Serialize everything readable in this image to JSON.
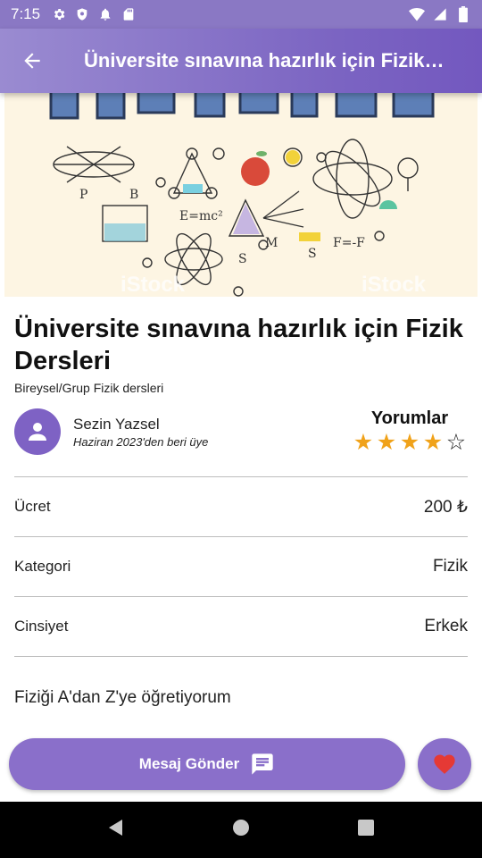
{
  "status_bar": {
    "time": "7:15",
    "icons_left": [
      "gear-icon",
      "shield-icon",
      "bell-icon",
      "sd-card-icon"
    ],
    "icons_right": [
      "wifi-icon",
      "signal-icon",
      "battery-icon"
    ]
  },
  "app_bar": {
    "title": "Üniversite sınavına hazırlık için Fizik Dersleri",
    "back_icon": "arrow-back-icon",
    "color_start": "#9a8bd1",
    "color_end": "#7358bf"
  },
  "hero": {
    "alt": "Physics illustration",
    "watermark": "iStock"
  },
  "listing": {
    "title": "Üniversite sınavına hazırlık için Fizik Dersleri",
    "subtitle": "Bireysel/Grup Fizik dersleri"
  },
  "owner": {
    "name": "Sezin Yazsel",
    "member_since": "Haziran 2023'den beri üye",
    "avatar_icon": "person-icon"
  },
  "reviews": {
    "title": "Yorumlar",
    "rating": 4,
    "max_rating": 5,
    "star_color": "#f0a21a"
  },
  "details": [
    {
      "label": "Ücret",
      "value": "200 ₺"
    },
    {
      "label": "Kategori",
      "value": "Fizik"
    },
    {
      "label": "Cinsiyet",
      "value": "Erkek"
    }
  ],
  "description": "Fiziği A'dan Z'ye öğretiyorum",
  "actions": {
    "message_label": "Mesaj Gönder",
    "message_icon": "chat-icon",
    "favorite_icon": "heart-icon",
    "button_color": "#8a6fca",
    "heart_color": "#e53935"
  },
  "nav_bar": {
    "back": "nav-back-icon",
    "home": "nav-home-icon",
    "recents": "nav-recents-icon"
  }
}
